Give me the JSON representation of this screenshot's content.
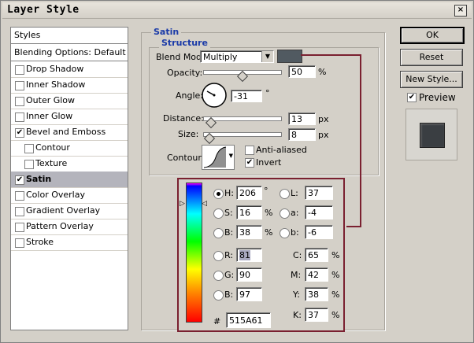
{
  "window": {
    "title": "Layer Style",
    "close": "×"
  },
  "styles_list": [
    {
      "label": "Styles",
      "type": "header"
    },
    {
      "label": "Blending Options: Default",
      "type": "header"
    },
    {
      "label": "Drop Shadow",
      "checked": false,
      "indent": 0
    },
    {
      "label": "Inner Shadow",
      "checked": false,
      "indent": 0
    },
    {
      "label": "Outer Glow",
      "checked": false,
      "indent": 0
    },
    {
      "label": "Inner Glow",
      "checked": false,
      "indent": 0
    },
    {
      "label": "Bevel and Emboss",
      "checked": true,
      "indent": 0
    },
    {
      "label": "Contour",
      "checked": false,
      "indent": 1
    },
    {
      "label": "Texture",
      "checked": false,
      "indent": 1
    },
    {
      "label": "Satin",
      "checked": true,
      "indent": 0,
      "selected": true
    },
    {
      "label": "Color Overlay",
      "checked": false,
      "indent": 0
    },
    {
      "label": "Gradient Overlay",
      "checked": false,
      "indent": 0
    },
    {
      "label": "Pattern Overlay",
      "checked": false,
      "indent": 0
    },
    {
      "label": "Stroke",
      "checked": false,
      "indent": 0
    }
  ],
  "satin": {
    "group_title": "Satin",
    "structure_title": "Structure",
    "blend_mode_label": "Blend Mode:",
    "blend_mode_value": "Multiply",
    "blend_color": "#515A61",
    "opacity_label": "Opacity:",
    "opacity_value": "50",
    "opacity_unit": "%",
    "opacity_fraction": 0.5,
    "angle_label": "Angle:",
    "angle_value": "-31",
    "angle_unit": "°",
    "distance_label": "Distance:",
    "distance_value": "13",
    "distance_unit": "px",
    "distance_fraction": 0.05,
    "size_label": "Size:",
    "size_value": "8",
    "size_unit": "px",
    "size_fraction": 0.03,
    "contour_label": "Contour:",
    "anti_aliased_label": "Anti-aliased",
    "anti_aliased_checked": false,
    "invert_label": "Invert",
    "invert_checked": true
  },
  "buttons": {
    "ok": "OK",
    "reset": "Reset",
    "new_style": "New Style...",
    "preview_label": "Preview",
    "preview_checked": true
  },
  "color_picker": {
    "h": {
      "label": "H:",
      "value": "206",
      "unit": "°",
      "selected": true
    },
    "s": {
      "label": "S:",
      "value": "16",
      "unit": "%"
    },
    "b": {
      "label": "B:",
      "value": "38",
      "unit": "%"
    },
    "r": {
      "label": "R:",
      "value": "81"
    },
    "g": {
      "label": "G:",
      "value": "90"
    },
    "bb": {
      "label": "B:",
      "value": "97"
    },
    "l": {
      "label": "L:",
      "value": "37"
    },
    "a": {
      "label": "a:",
      "value": "-4"
    },
    "b_lab": {
      "label": "b:",
      "value": "-6"
    },
    "c": {
      "label": "C:",
      "value": "65",
      "unit": "%"
    },
    "m": {
      "label": "M:",
      "value": "42",
      "unit": "%"
    },
    "y": {
      "label": "Y:",
      "value": "38",
      "unit": "%"
    },
    "k": {
      "label": "K:",
      "value": "37",
      "unit": "%"
    },
    "hex_label": "#",
    "hex_value": "515A61"
  },
  "colors": {
    "accent_title": "#1a3aa8",
    "callout": "#7a2030",
    "preview_swatch": "#3a3e42"
  }
}
